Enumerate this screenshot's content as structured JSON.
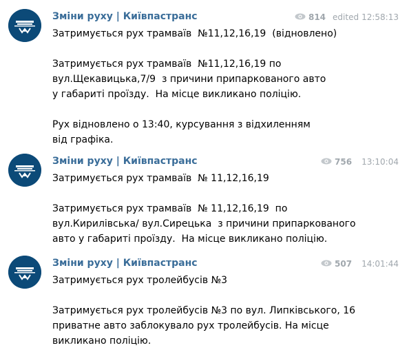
{
  "brand": {
    "author_color": "#3a6d99",
    "avatar_color": "#0c4a78",
    "meta_color": "#a0a7ad"
  },
  "messages": [
    {
      "author": "Зміни руху | Київпастранс",
      "views": "814",
      "edited": "edited",
      "time": "12:58:13",
      "paragraphs": [
        "Затримується рух трамваїв  №11,12,16,19  (відновлено)",
        "Затримується рух трамваїв  №11,12,16,19 по вул.Щекавицька,7/9  з причини припаркованого авто у габариті проїзду.  На місце викликано поліцію.",
        "Рух відновлено о 13:40, курсування з відхиленням від графіка."
      ]
    },
    {
      "author": "Зміни руху | Київпастранс",
      "views": "756",
      "time": "13:10:04",
      "paragraphs": [
        "Затримується рух трамваїв  № 11,12,16,19",
        "Затримується рух трамваїв  № 11,12,16,19  по вул.Кирилівська/ вул.Сирецька  з причини припаркованого авто у габариті проїзду.  На місце викликано поліцію."
      ]
    },
    {
      "author": "Зміни руху | Київпастранс",
      "views": "507",
      "time": "14:01:44",
      "paragraphs": [
        "Затримується рух тролейбусів №3",
        "Затримується рух тролейбусів №3 по вул. Липківського, 16 приватне авто заблокувало рух тролейбусів. На місце викликано поліцію."
      ]
    }
  ]
}
